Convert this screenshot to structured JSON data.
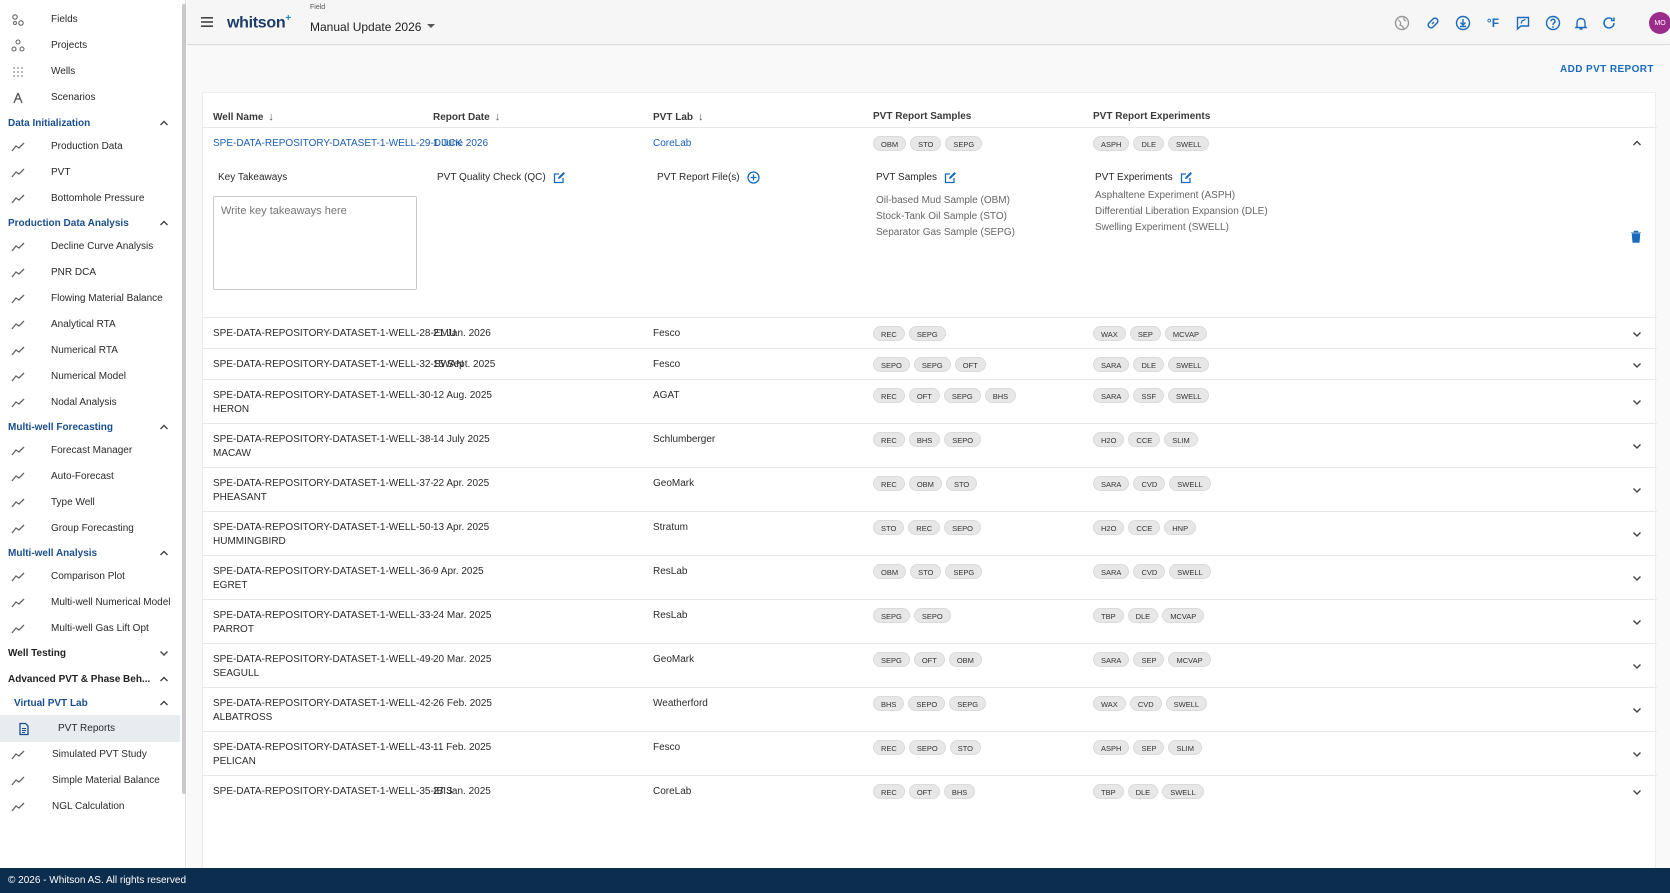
{
  "sidebar": {
    "top_items": [
      {
        "label": "Fields",
        "icon": "fields-icon"
      },
      {
        "label": "Projects",
        "icon": "projects-icon"
      },
      {
        "label": "Wells",
        "icon": "wells-icon"
      },
      {
        "label": "Scenarios",
        "icon": "scenarios-icon"
      }
    ],
    "sections": [
      {
        "title": "Data Initialization",
        "items": [
          "Production Data",
          "PVT",
          "Bottomhole Pressure"
        ]
      },
      {
        "title": "Production Data Analysis",
        "items": [
          "Decline Curve Analysis",
          "PNR DCA",
          "Flowing Material Balance",
          "Analytical RTA",
          "Numerical RTA",
          "Numerical Model",
          "Nodal Analysis"
        ]
      },
      {
        "title": "Multi-well Forecasting",
        "items": [
          "Forecast Manager",
          "Auto-Forecast",
          "Type Well",
          "Group Forecasting"
        ]
      },
      {
        "title": "Multi-well Analysis",
        "items": [
          "Comparison Plot",
          "Multi-well Numerical Model",
          "Multi-well Gas Lift Opt"
        ]
      },
      {
        "title": "Well Testing",
        "items": []
      },
      {
        "title": "Advanced PVT & Phase Beh...",
        "items": []
      }
    ],
    "subsection": {
      "title": "Virtual PVT Lab",
      "items": [
        "PVT Reports",
        "Simulated PVT Study",
        "Simple Material Balance",
        "NGL Calculation"
      ],
      "active": "PVT Reports"
    }
  },
  "topbar": {
    "logo": "whitson",
    "logo_sup": "+",
    "field_label": "Field",
    "field_value": "Manual Update 2026",
    "temp_unit": "°F",
    "avatar": "MO"
  },
  "main": {
    "add_button": "ADD PVT REPORT",
    "columns": [
      "Well Name",
      "Report Date",
      "PVT Lab",
      "PVT Report Samples",
      "PVT Report Experiments"
    ],
    "expanded": {
      "well": "SPE-DATA-REPOSITORY-DATASET-1-WELL-29-DUCK",
      "date": "1 June 2026",
      "lab": "CoreLab",
      "samples": [
        "OBM",
        "STO",
        "SEPG"
      ],
      "experiments": [
        "ASPH",
        "DLE",
        "SWELL"
      ],
      "key_takeaways_label": "Key Takeaways",
      "key_takeaways_placeholder": "Write key takeaways here",
      "qc_label": "PVT Quality Check (QC)",
      "files_label": "PVT Report File(s)",
      "samples_label": "PVT Samples",
      "samples_list": [
        "Oil-based Mud Sample (OBM)",
        "Stock-Tank Oil Sample (STO)",
        "Separator Gas Sample (SEPG)"
      ],
      "experiments_label": "PVT Experiments",
      "experiments_list": [
        "Asphaltene Experiment (ASPH)",
        "Differential Liberation Expansion (DLE)",
        "Swelling Experiment (SWELL)"
      ]
    },
    "rows": [
      {
        "well": [
          "SPE-DATA-REPOSITORY-DATASET-1-WELL-28-EMU"
        ],
        "date": "21 Jan. 2026",
        "lab": "Fesco",
        "samples": [
          "REC",
          "SEPG"
        ],
        "experiments": [
          "WAX",
          "SEP",
          "MCVAP"
        ]
      },
      {
        "well": [
          "SPE-DATA-REPOSITORY-DATASET-1-WELL-32-SWAN"
        ],
        "date": "15 Sept. 2025",
        "lab": "Fesco",
        "samples": [
          "SEPO",
          "SEPG",
          "OFT"
        ],
        "experiments": [
          "SARA",
          "DLE",
          "SWELL"
        ]
      },
      {
        "well": [
          "SPE-DATA-REPOSITORY-DATASET-1-WELL-30-",
          "HERON"
        ],
        "date": "12 Aug. 2025",
        "lab": "AGAT",
        "samples": [
          "REC",
          "OFT",
          "SEPG",
          "BHS"
        ],
        "experiments": [
          "SARA",
          "SSF",
          "SWELL"
        ]
      },
      {
        "well": [
          "SPE-DATA-REPOSITORY-DATASET-1-WELL-38-",
          "MACAW"
        ],
        "date": "14 July 2025",
        "lab": "Schlumberger",
        "samples": [
          "REC",
          "BHS",
          "SEPO"
        ],
        "experiments": [
          "H2O",
          "CCE",
          "SLIM"
        ]
      },
      {
        "well": [
          "SPE-DATA-REPOSITORY-DATASET-1-WELL-37-",
          "PHEASANT"
        ],
        "date": "22 Apr. 2025",
        "lab": "GeoMark",
        "samples": [
          "REC",
          "OBM",
          "STO"
        ],
        "experiments": [
          "SARA",
          "CVD",
          "SWELL"
        ]
      },
      {
        "well": [
          "SPE-DATA-REPOSITORY-DATASET-1-WELL-50-",
          "HUMMINGBIRD"
        ],
        "date": "13 Apr. 2025",
        "lab": "Stratum",
        "samples": [
          "STO",
          "REC",
          "SEPO"
        ],
        "experiments": [
          "H2O",
          "CCE",
          "HNP"
        ]
      },
      {
        "well": [
          "SPE-DATA-REPOSITORY-DATASET-1-WELL-36-",
          "EGRET"
        ],
        "date": "9 Apr. 2025",
        "lab": "ResLab",
        "samples": [
          "OBM",
          "STO",
          "SEPG"
        ],
        "experiments": [
          "SARA",
          "CVD",
          "SWELL"
        ]
      },
      {
        "well": [
          "SPE-DATA-REPOSITORY-DATASET-1-WELL-33-",
          "PARROT"
        ],
        "date": "24 Mar. 2025",
        "lab": "ResLab",
        "samples": [
          "SEPG",
          "SEPO"
        ],
        "experiments": [
          "TBP",
          "DLE",
          "MCVAP"
        ]
      },
      {
        "well": [
          "SPE-DATA-REPOSITORY-DATASET-1-WELL-49-",
          "SEAGULL"
        ],
        "date": "20 Mar. 2025",
        "lab": "GeoMark",
        "samples": [
          "SEPG",
          "OFT",
          "OBM"
        ],
        "experiments": [
          "SARA",
          "SEP",
          "MCVAP"
        ]
      },
      {
        "well": [
          "SPE-DATA-REPOSITORY-DATASET-1-WELL-42-",
          "ALBATROSS"
        ],
        "date": "26 Feb. 2025",
        "lab": "Weatherford",
        "samples": [
          "BHS",
          "SEPO",
          "SEPG"
        ],
        "experiments": [
          "WAX",
          "CVD",
          "SWELL"
        ]
      },
      {
        "well": [
          "SPE-DATA-REPOSITORY-DATASET-1-WELL-43-",
          "PELICAN"
        ],
        "date": "11 Feb. 2025",
        "lab": "Fesco",
        "samples": [
          "REC",
          "SEPO",
          "STO"
        ],
        "experiments": [
          "ASPH",
          "SEP",
          "SLIM"
        ]
      },
      {
        "well": [
          "SPE-DATA-REPOSITORY-DATASET-1-WELL-35-IBIS"
        ],
        "date": "27 Jan. 2025",
        "lab": "CoreLab",
        "samples": [
          "REC",
          "OFT",
          "BHS"
        ],
        "experiments": [
          "TBP",
          "DLE",
          "SWELL"
        ]
      }
    ]
  },
  "footer": {
    "text": "© 2026 - Whitson AS. All rights reserved"
  },
  "colors": {
    "accent": "#1a6bbd",
    "footer": "#0d2d4f",
    "avatar": "#9c2c8c"
  }
}
